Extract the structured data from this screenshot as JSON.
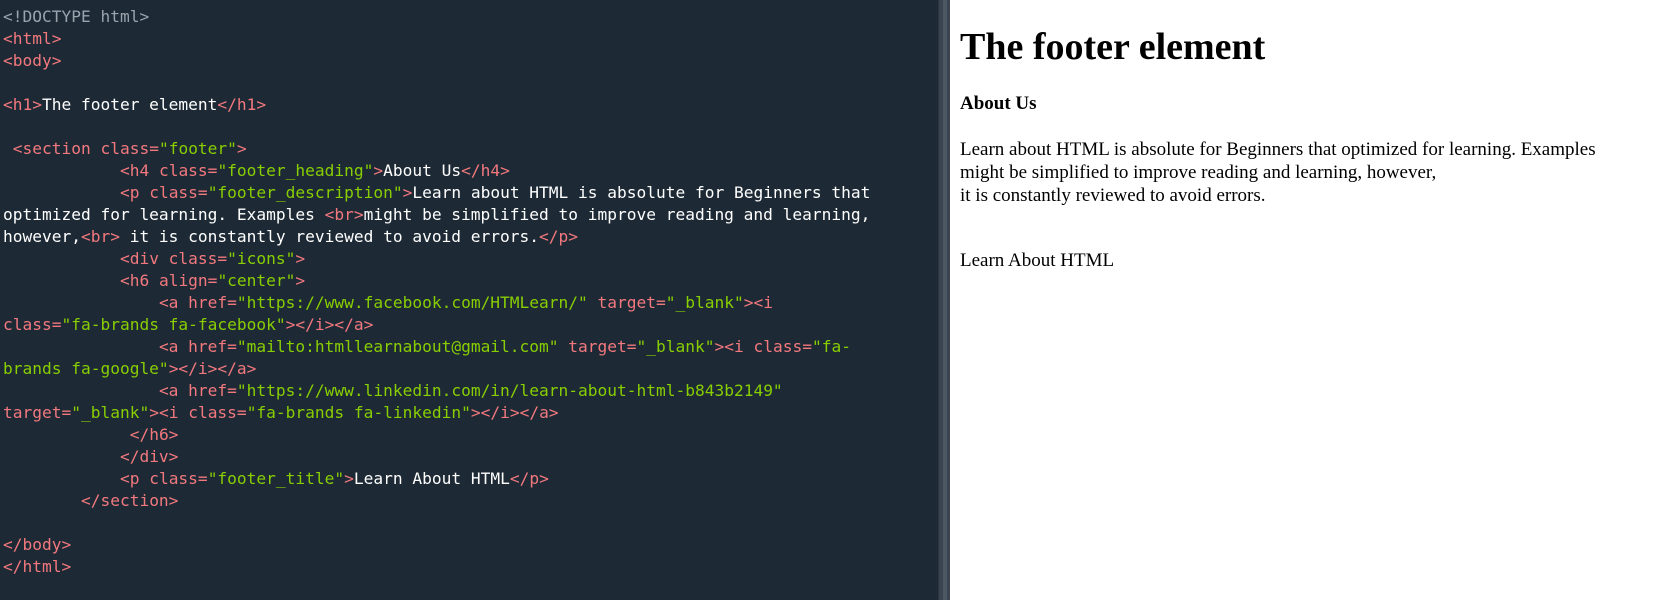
{
  "editor": {
    "lines": [
      [
        {
          "c": "tk-doctype",
          "t": "<!DOCTYPE html>"
        }
      ],
      [
        {
          "c": "tk-tag",
          "t": "<html>"
        }
      ],
      [
        {
          "c": "tk-tag",
          "t": "<body>"
        }
      ],
      [],
      [
        {
          "c": "tk-tag",
          "t": "<h1>"
        },
        {
          "c": "tk-text",
          "t": "The footer element"
        },
        {
          "c": "tk-tag",
          "t": "</h1>"
        }
      ],
      [],
      [
        {
          "c": "tk-text",
          "t": " "
        },
        {
          "c": "tk-tag",
          "t": "<section"
        },
        {
          "c": "tk-attr",
          "t": " class="
        },
        {
          "c": "tk-val",
          "t": "\"footer\""
        },
        {
          "c": "tk-tag",
          "t": ">"
        }
      ],
      [
        {
          "c": "tk-text",
          "t": "            "
        },
        {
          "c": "tk-tag",
          "t": "<h4"
        },
        {
          "c": "tk-attr",
          "t": " class="
        },
        {
          "c": "tk-val",
          "t": "\"footer_heading\""
        },
        {
          "c": "tk-tag",
          "t": ">"
        },
        {
          "c": "tk-text",
          "t": "About Us"
        },
        {
          "c": "tk-tag",
          "t": "</h4>"
        }
      ],
      [
        {
          "c": "tk-text",
          "t": "            "
        },
        {
          "c": "tk-tag",
          "t": "<p"
        },
        {
          "c": "tk-attr",
          "t": " class="
        },
        {
          "c": "tk-val",
          "t": "\"footer_description\""
        },
        {
          "c": "tk-tag",
          "t": ">"
        },
        {
          "c": "tk-text",
          "t": "Learn about HTML is absolute for Beginners that"
        }
      ],
      [
        {
          "c": "tk-text",
          "t": "optimized for learning. Examples "
        },
        {
          "c": "tk-tag",
          "t": "<br>"
        },
        {
          "c": "tk-text",
          "t": "might be simplified to improve reading and learning,"
        }
      ],
      [
        {
          "c": "tk-text",
          "t": "however,"
        },
        {
          "c": "tk-tag",
          "t": "<br>"
        },
        {
          "c": "tk-text",
          "t": " it is constantly reviewed to avoid errors."
        },
        {
          "c": "tk-tag",
          "t": "</p>"
        }
      ],
      [
        {
          "c": "tk-text",
          "t": "            "
        },
        {
          "c": "tk-tag",
          "t": "<div"
        },
        {
          "c": "tk-attr",
          "t": " class="
        },
        {
          "c": "tk-val",
          "t": "\"icons\""
        },
        {
          "c": "tk-tag",
          "t": ">"
        }
      ],
      [
        {
          "c": "tk-text",
          "t": "            "
        },
        {
          "c": "tk-tag",
          "t": "<h6"
        },
        {
          "c": "tk-attr",
          "t": " align="
        },
        {
          "c": "tk-val",
          "t": "\"center\""
        },
        {
          "c": "tk-tag",
          "t": ">"
        }
      ],
      [
        {
          "c": "tk-text",
          "t": "                "
        },
        {
          "c": "tk-tag",
          "t": "<a"
        },
        {
          "c": "tk-attr",
          "t": " href="
        },
        {
          "c": "tk-val",
          "t": "\"https://www.facebook.com/HTMLearn/\""
        },
        {
          "c": "tk-attr",
          "t": " target="
        },
        {
          "c": "tk-val",
          "t": "\"_blank\""
        },
        {
          "c": "tk-tag",
          "t": "><i"
        }
      ],
      [
        {
          "c": "tk-attr",
          "t": "class="
        },
        {
          "c": "tk-val",
          "t": "\"fa-brands fa-facebook\""
        },
        {
          "c": "tk-tag",
          "t": "></i></a>"
        }
      ],
      [
        {
          "c": "tk-text",
          "t": "                "
        },
        {
          "c": "tk-tag",
          "t": "<a"
        },
        {
          "c": "tk-attr",
          "t": " href="
        },
        {
          "c": "tk-val",
          "t": "\"mailto:htmllearnabout@gmail.com\""
        },
        {
          "c": "tk-attr",
          "t": " target="
        },
        {
          "c": "tk-val",
          "t": "\"_blank\""
        },
        {
          "c": "tk-tag",
          "t": "><i"
        },
        {
          "c": "tk-attr",
          "t": " class="
        },
        {
          "c": "tk-val",
          "t": "\"fa-"
        }
      ],
      [
        {
          "c": "tk-val",
          "t": "brands fa-google\""
        },
        {
          "c": "tk-tag",
          "t": "></i></a>"
        }
      ],
      [
        {
          "c": "tk-text",
          "t": "                "
        },
        {
          "c": "tk-tag",
          "t": "<a"
        },
        {
          "c": "tk-attr",
          "t": " href="
        },
        {
          "c": "tk-val",
          "t": "\"https://www.linkedin.com/in/learn-about-html-b843b2149\""
        }
      ],
      [
        {
          "c": "tk-attr",
          "t": "target="
        },
        {
          "c": "tk-val",
          "t": "\"_blank\""
        },
        {
          "c": "tk-tag",
          "t": "><i"
        },
        {
          "c": "tk-attr",
          "t": " class="
        },
        {
          "c": "tk-val",
          "t": "\"fa-brands fa-linkedin\""
        },
        {
          "c": "tk-tag",
          "t": "></i></a>"
        }
      ],
      [
        {
          "c": "tk-text",
          "t": "             "
        },
        {
          "c": "tk-tag",
          "t": "</h6>"
        }
      ],
      [
        {
          "c": "tk-text",
          "t": "            "
        },
        {
          "c": "tk-tag",
          "t": "</div>"
        }
      ],
      [
        {
          "c": "tk-text",
          "t": "            "
        },
        {
          "c": "tk-tag",
          "t": "<p"
        },
        {
          "c": "tk-attr",
          "t": " class="
        },
        {
          "c": "tk-val",
          "t": "\"footer_title\""
        },
        {
          "c": "tk-tag",
          "t": ">"
        },
        {
          "c": "tk-text",
          "t": "Learn About HTML"
        },
        {
          "c": "tk-tag",
          "t": "</p>"
        }
      ],
      [
        {
          "c": "tk-text",
          "t": "        "
        },
        {
          "c": "tk-tag",
          "t": "</section>"
        }
      ],
      [],
      [
        {
          "c": "tk-tag",
          "t": "</body>"
        }
      ],
      [
        {
          "c": "tk-tag",
          "t": "</html>"
        }
      ]
    ]
  },
  "preview": {
    "h1": "The footer element",
    "h4": "About Us",
    "desc_line1": "Learn about HTML is absolute for Beginners that optimized for learning. Examples",
    "desc_line2": "might be simplified to improve reading and learning, however,",
    "desc_line3": " it is constantly reviewed to avoid errors.",
    "footer_title": "Learn About HTML"
  },
  "colors": {
    "editor_bg": "#1d2a35",
    "tag": "#f2787e",
    "value": "#88ce02",
    "text": "#ffffff",
    "doctype": "#9ba3ad"
  }
}
